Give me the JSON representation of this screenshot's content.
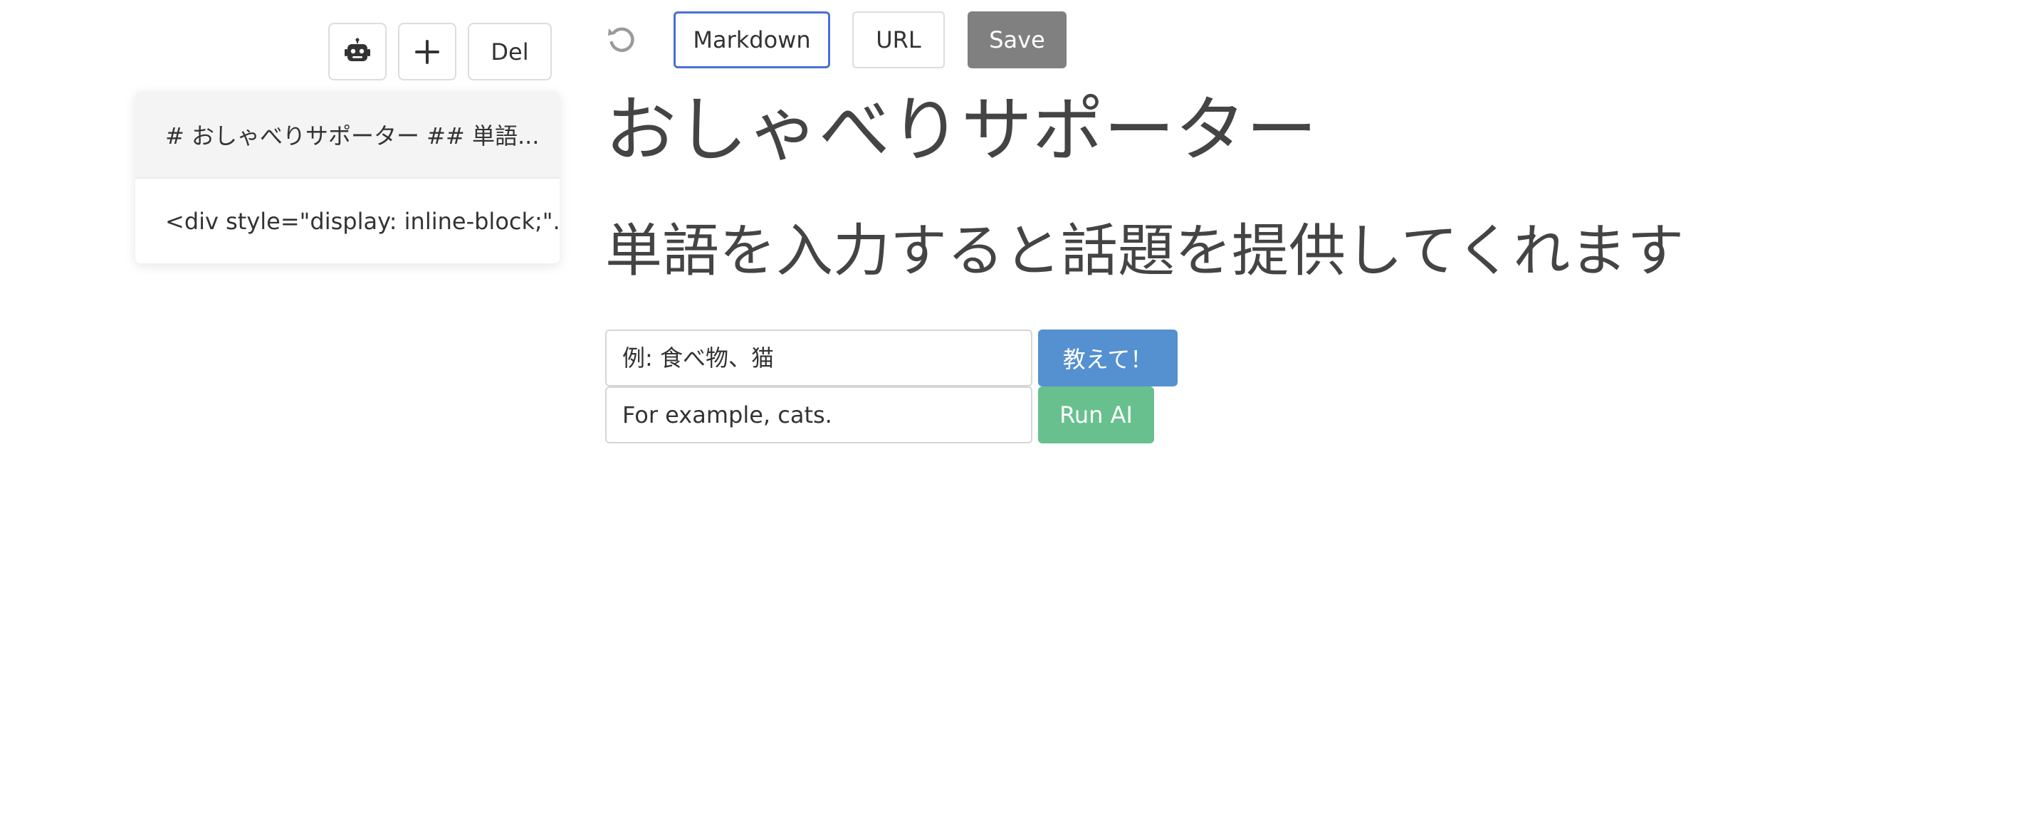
{
  "sidebar": {
    "toolbar": {
      "robot_icon": "robot-icon",
      "add_icon": "plus-icon",
      "del_label": "Del"
    },
    "items": [
      {
        "label": "# おしゃべりサポーター ## 単語..."
      },
      {
        "label": "<div style=\"display: inline-block;\"..."
      }
    ]
  },
  "editor": {
    "toolbar": {
      "undo_icon": "undo-icon",
      "markdown_label": "Markdown",
      "url_label": "URL",
      "save_label": "Save"
    }
  },
  "content": {
    "title": "おしゃべりサポーター",
    "subtitle": "単語を入力すると話題を提供してくれます",
    "form_jp": {
      "placeholder": "例: 食べ物、猫",
      "button_label": "教えて！"
    },
    "form_en": {
      "placeholder": "For example, cats.",
      "button_label": "Run AI"
    }
  },
  "colors": {
    "markdown_border": "#4a6fd6",
    "save_bg": "#808080",
    "tell_bg": "#5590d0",
    "runai_bg": "#68c08e"
  }
}
